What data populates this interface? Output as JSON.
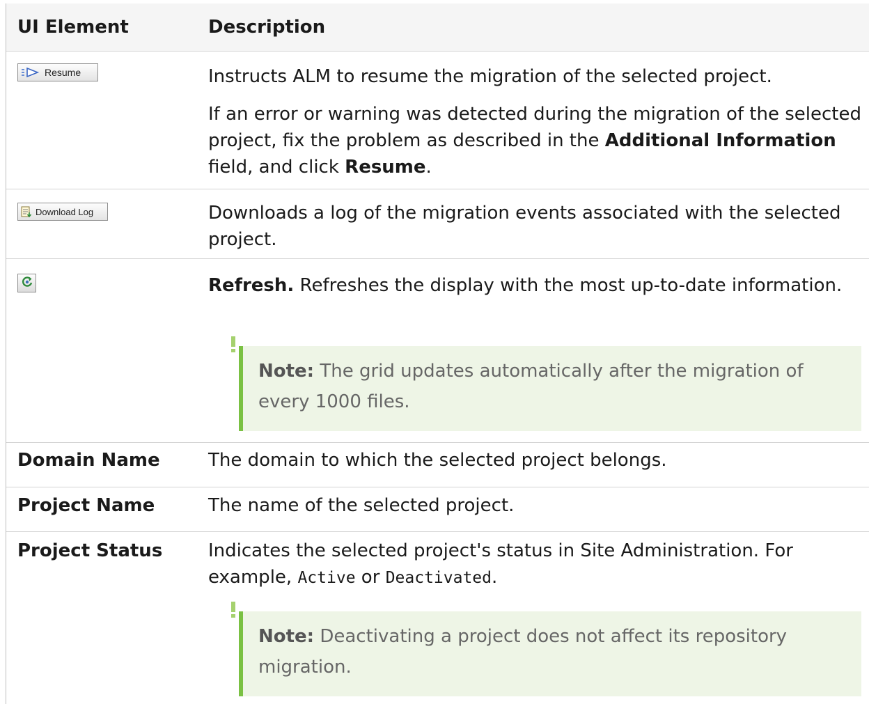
{
  "table": {
    "header": {
      "col_element": "UI Element",
      "col_description": "Description"
    },
    "rows": [
      {
        "button_label": "Resume",
        "icon": "resume-play-icon",
        "description": {
          "p1": "Instructs ALM to resume the migration of the selected project.",
          "p2_text1": "If an error or warning was detected during the migration of the selected project, fix the problem as described in the ",
          "p2_bold1": "Additional Information",
          "p2_text2": " field, and click ",
          "p2_bold2": "Resume",
          "p2_text3": "."
        }
      },
      {
        "button_label": "Download Log",
        "icon": "download-log-icon",
        "description": {
          "p1": "Downloads a log of the migration events associated with the selected project."
        }
      },
      {
        "icon": "refresh-icon",
        "description": {
          "bold": "Refresh.",
          "text": " Refreshes the display with the most up-to-date information."
        },
        "note": {
          "label": "Note:",
          "text": " The grid updates automatically after the migration of every 1000 files."
        }
      },
      {
        "element": "Domain Name",
        "description": "The domain to which the selected project belongs."
      },
      {
        "element": "Project Name",
        "description": "The name of the selected project."
      },
      {
        "element": "Project Status",
        "description": {
          "text1": "Indicates the selected project's status in Site Administration. For example, ",
          "code1": "Active",
          "text2": " or ",
          "code2": "Deactivated",
          "text3": "."
        },
        "note": {
          "label": "Note:",
          "text": " Deactivating a project does not affect its repository migration."
        }
      }
    ]
  },
  "colors": {
    "note_background": "#eef5e6",
    "note_accent": "#7ac143",
    "header_background": "#f5f5f5"
  }
}
